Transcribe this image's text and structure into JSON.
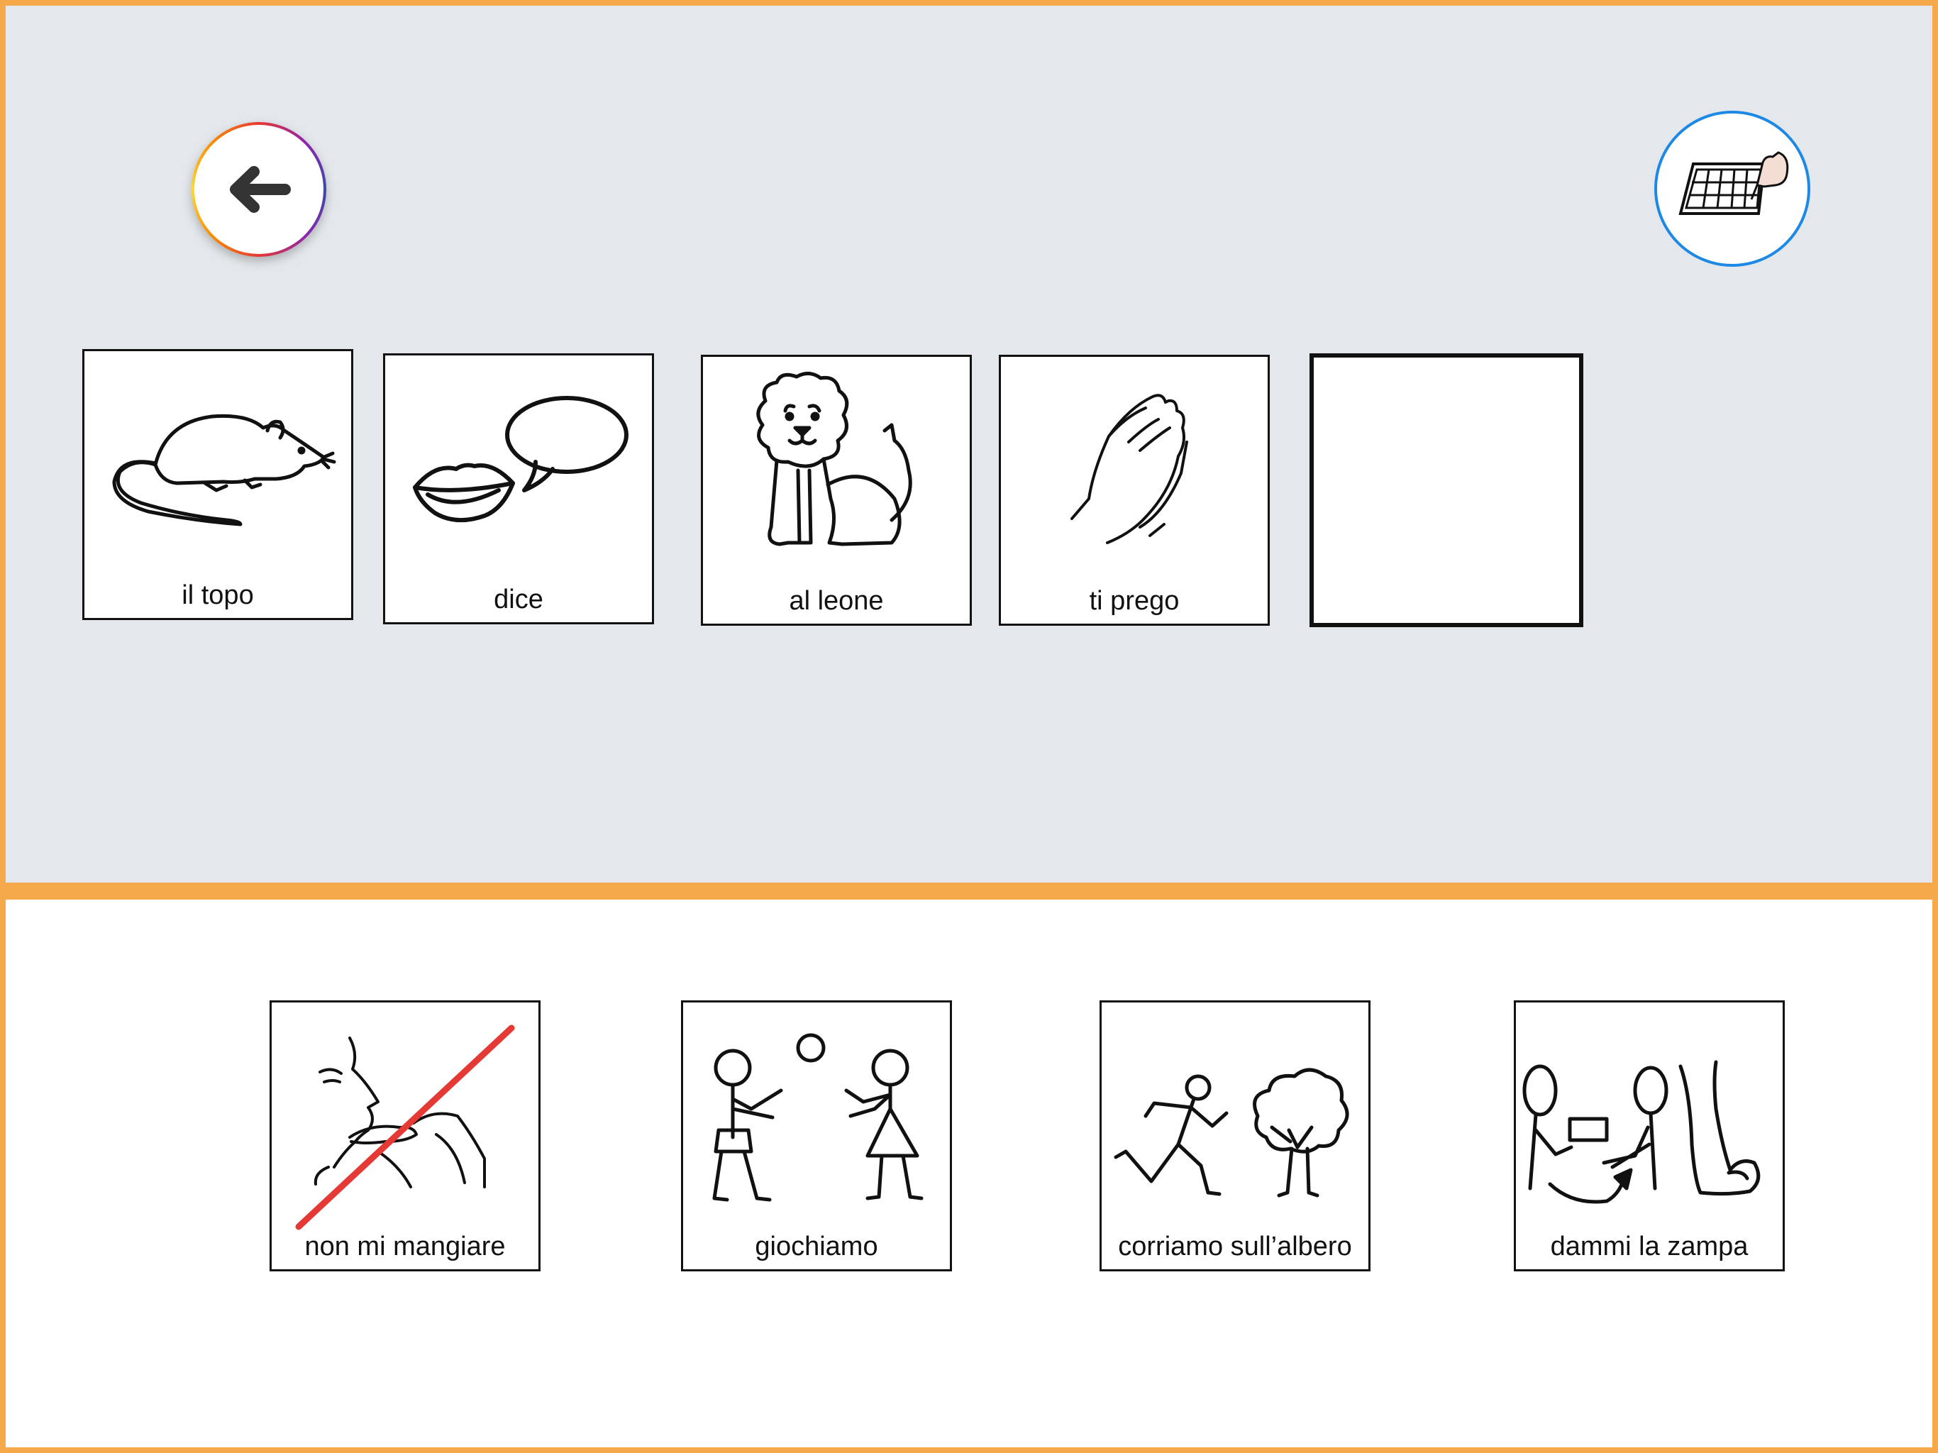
{
  "header": {
    "back_icon": "arrow-left-icon",
    "keyboard_icon": "symbol-grid-keyboard-icon",
    "accent_color": "#F5A94A",
    "back_ring_colors": [
      "#e53935",
      "#8e24aa",
      "#fb8c00"
    ],
    "keyboard_ring_color": "#1E88E5"
  },
  "sentence": {
    "cards": [
      {
        "label": "il topo",
        "icon": "mouse-icon"
      },
      {
        "label": "dice",
        "icon": "speaking-lips-icon"
      },
      {
        "label": "al leone",
        "icon": "lion-icon"
      },
      {
        "label": "ti prego",
        "icon": "praying-hands-icon"
      }
    ],
    "empty_slot_count": 1
  },
  "choices": {
    "cards": [
      {
        "label": "non mi mangiare",
        "icon": "dont-eat-me-icon"
      },
      {
        "label": "giochiamo",
        "icon": "play-ball-icon"
      },
      {
        "label": "corriamo sull’albero",
        "icon": "run-to-tree-icon"
      },
      {
        "label": "dammi la zampa",
        "icon": "give-paw-icon"
      }
    ]
  }
}
